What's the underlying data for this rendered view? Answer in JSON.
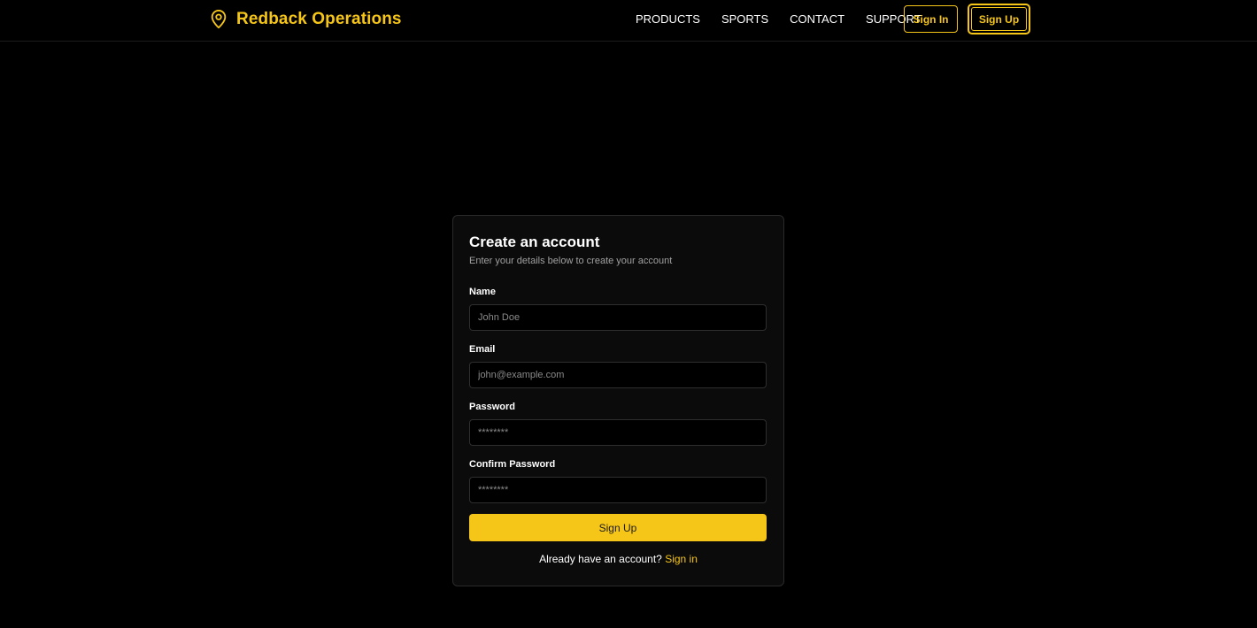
{
  "header": {
    "brand_name": "Redback Operations",
    "brand_icon": "map-pin-icon",
    "nav": [
      {
        "label": "PRODUCTS"
      },
      {
        "label": "SPORTS"
      },
      {
        "label": "CONTACT"
      },
      {
        "label": "SUPPORT"
      }
    ],
    "sign_in_label": "Sign In",
    "sign_up_label": "Sign Up"
  },
  "form": {
    "title": "Create an account",
    "subtitle": "Enter your details below to create your account",
    "fields": {
      "name": {
        "label": "Name",
        "placeholder": "John Doe"
      },
      "email": {
        "label": "Email",
        "placeholder": "john@example.com"
      },
      "password": {
        "label": "Password",
        "placeholder": "********"
      },
      "confirm_password": {
        "label": "Confirm Password",
        "placeholder": "********"
      }
    },
    "submit_label": "Sign Up",
    "footer_text": "Already have an account?",
    "footer_link": "Sign in"
  },
  "colors": {
    "accent": "#f5c518",
    "background": "#000000",
    "card": "#0b0b0b"
  }
}
